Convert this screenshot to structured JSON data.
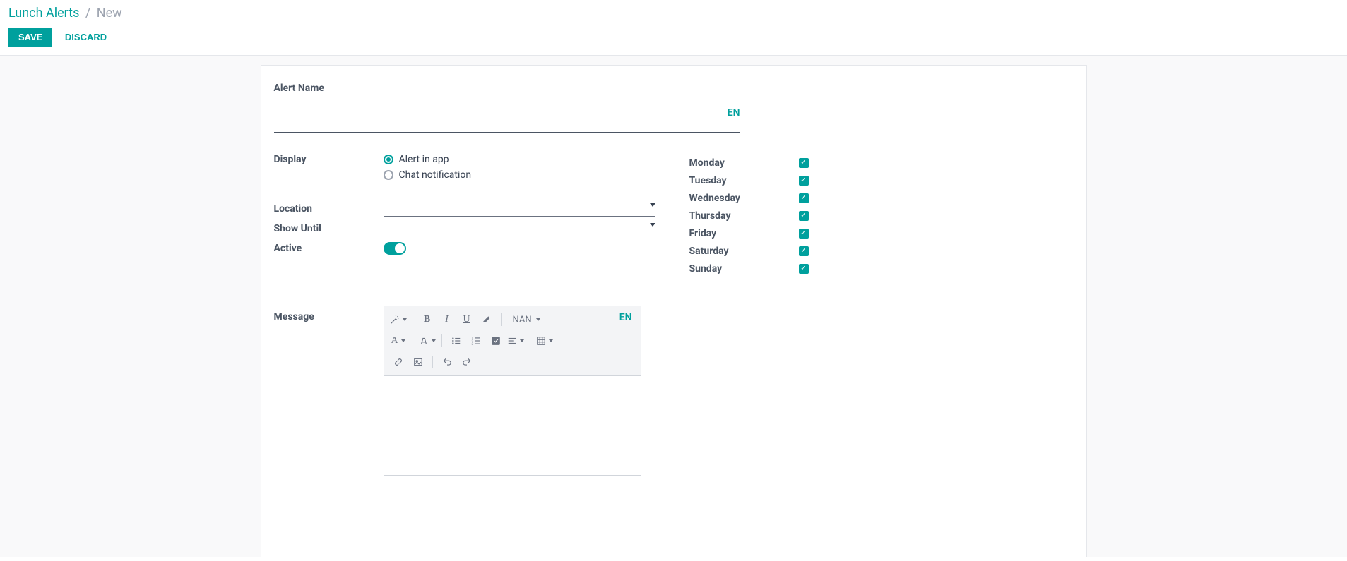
{
  "breadcrumb": {
    "parent": "Lunch Alerts",
    "sep": "/",
    "current": "New"
  },
  "buttons": {
    "save": "SAVE",
    "discard": "DISCARD"
  },
  "form": {
    "alert_name_label": "Alert Name",
    "alert_name_value": "",
    "lang_badge": "EN",
    "display_label": "Display",
    "display_options": {
      "app": "Alert in app",
      "chat": "Chat notification"
    },
    "display_selected": "app",
    "location_label": "Location",
    "location_value": "",
    "show_until_label": "Show Until",
    "show_until_value": "",
    "active_label": "Active",
    "active_value": true,
    "days": [
      {
        "label": "Monday",
        "checked": true
      },
      {
        "label": "Tuesday",
        "checked": true
      },
      {
        "label": "Wednesday",
        "checked": true
      },
      {
        "label": "Thursday",
        "checked": true
      },
      {
        "label": "Friday",
        "checked": true
      },
      {
        "label": "Saturday",
        "checked": true
      },
      {
        "label": "Sunday",
        "checked": true
      }
    ],
    "message_label": "Message",
    "editor": {
      "font_name": "NAN",
      "lang": "EN"
    }
  }
}
